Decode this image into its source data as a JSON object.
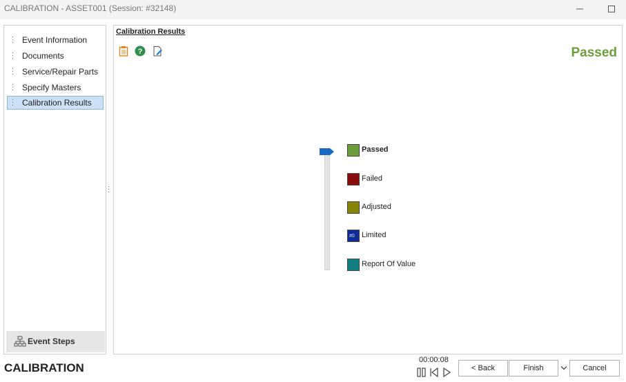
{
  "window": {
    "title": "CALIBRATION - ASSET001 (Session: #32148)",
    "minimize_label": "—"
  },
  "sidebar": {
    "items": [
      {
        "label": "Event Information",
        "selected": false
      },
      {
        "label": "Documents",
        "selected": false
      },
      {
        "label": "Service/Repair Parts",
        "selected": false
      },
      {
        "label": "Specify Masters",
        "selected": false
      },
      {
        "label": "Calibration Results",
        "selected": true
      }
    ],
    "event_steps_label": "Event Steps",
    "event_steps_icon": "hierarchy-icon"
  },
  "main": {
    "heading": "Calibration Results",
    "toolbar_icons": [
      "clipboard-icon",
      "help-icon",
      "edit-document-icon"
    ],
    "status": "Passed",
    "status_color": "#6a9f3a",
    "slider_selected_index": 0,
    "results": [
      {
        "label": "Passed",
        "color": "#6e9c3c",
        "active": true
      },
      {
        "label": "Failed",
        "color": "#8a0b0b",
        "active": false
      },
      {
        "label": "Adjusted",
        "color": "#858407",
        "active": false
      },
      {
        "label": "Limited",
        "color": "#122a94",
        "active": false,
        "mini_text": "#0"
      },
      {
        "label": "Report Of Value",
        "color": "#11807f",
        "active": false
      }
    ]
  },
  "footer": {
    "title": "CALIBRATION",
    "timer": "00:00:08",
    "media_icons": [
      "pause-icon",
      "skip-back-icon",
      "play-icon"
    ],
    "back_label": "< Back",
    "finish_label": "Finish",
    "finish_dropdown": "chevron-down-icon",
    "cancel_label": "Cancel"
  }
}
